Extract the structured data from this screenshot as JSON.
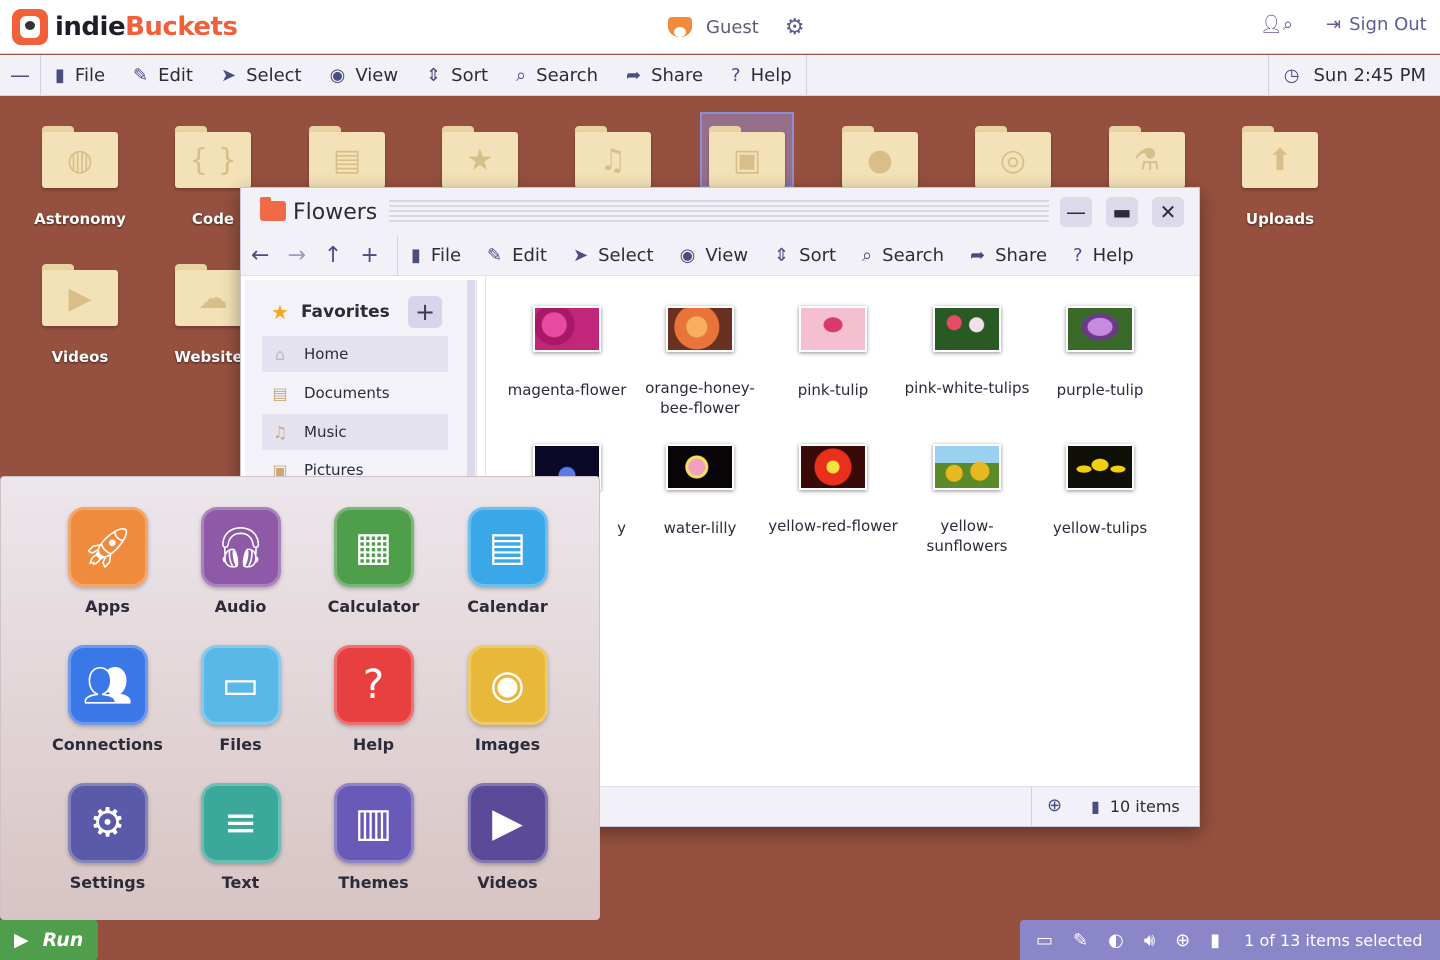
{
  "topbar": {
    "logo_part1": "indie",
    "logo_part2": "Buckets",
    "user": "Guest",
    "signout": "Sign Out"
  },
  "menubar": {
    "items": [
      "File",
      "Edit",
      "Select",
      "View",
      "Sort",
      "Search",
      "Share",
      "Help"
    ],
    "clock": "Sun 2:45 PM"
  },
  "desktop": {
    "folders": [
      {
        "label": "Astronomy",
        "icon": "planet-icon"
      },
      {
        "label": "Code",
        "icon": "braces-icon"
      },
      {
        "label": "",
        "icon": "document-icon"
      },
      {
        "label": "",
        "icon": "star-icon"
      },
      {
        "label": "",
        "icon": "music-icon"
      },
      {
        "label": "",
        "icon": "pictures-icon"
      },
      {
        "label": "",
        "icon": "person-icon"
      },
      {
        "label": "",
        "icon": "globe-icon"
      },
      {
        "label": "",
        "icon": "flask-icon"
      },
      {
        "label": "Uploads",
        "icon": "upload-icon"
      },
      {
        "label": "Videos",
        "icon": "clapper-icon"
      },
      {
        "label": "Websites",
        "icon": "cloud-icon"
      }
    ]
  },
  "window": {
    "title": "Flowers",
    "toolbar": [
      "File",
      "Edit",
      "Select",
      "View",
      "Sort",
      "Search",
      "Share",
      "Help"
    ],
    "sidebar": {
      "favorites_label": "Favorites",
      "items": [
        "Home",
        "Documents",
        "Music",
        "Pictures"
      ]
    },
    "files": [
      {
        "name": "magenta-flower",
        "color": "#c2267a"
      },
      {
        "name": "orange-honey-bee-flower",
        "color": "#e8743a"
      },
      {
        "name": "pink-tulip",
        "color": "#f0a6c0"
      },
      {
        "name": "pink-white-tulips",
        "color": "#3c6a2c"
      },
      {
        "name": "purple-tulip",
        "color": "#8c5aa8"
      },
      {
        "name": "y",
        "color": "#1a2a6c"
      },
      {
        "name": "water-lilly",
        "color": "#1a0a10"
      },
      {
        "name": "yellow-red-flower",
        "color": "#d8301c"
      },
      {
        "name": "yellow-sunflowers",
        "color": "#d8b020"
      },
      {
        "name": "yellow-tulips",
        "color": "#e8c010"
      }
    ],
    "status": "10 items"
  },
  "launcher": {
    "apps": [
      {
        "label": "Apps",
        "icon": "rocket-icon",
        "color": "#f08a3c"
      },
      {
        "label": "Audio",
        "icon": "headphones-icon",
        "color": "#8e5aa8"
      },
      {
        "label": "Calculator",
        "icon": "calculator-icon",
        "color": "#4f9e4c"
      },
      {
        "label": "Calendar",
        "icon": "calendar-icon",
        "color": "#3aa8e8"
      },
      {
        "label": "Connections",
        "icon": "people-icon",
        "color": "#3a78e8"
      },
      {
        "label": "Files",
        "icon": "folder-icon",
        "color": "#5ab8e8"
      },
      {
        "label": "Help",
        "icon": "question-icon",
        "color": "#e84040"
      },
      {
        "label": "Images",
        "icon": "camera-icon",
        "color": "#e8b83a"
      },
      {
        "label": "Settings",
        "icon": "gears-icon",
        "color": "#5a5aa8"
      },
      {
        "label": "Text",
        "icon": "text-document-icon",
        "color": "#3aa89a"
      },
      {
        "label": "Themes",
        "icon": "palette-icon",
        "color": "#6a5ab8"
      },
      {
        "label": "Videos",
        "icon": "play-icon",
        "color": "#5a4a98"
      }
    ]
  },
  "taskbar": {
    "run": "Run",
    "status": "1 of 13 items selected"
  }
}
